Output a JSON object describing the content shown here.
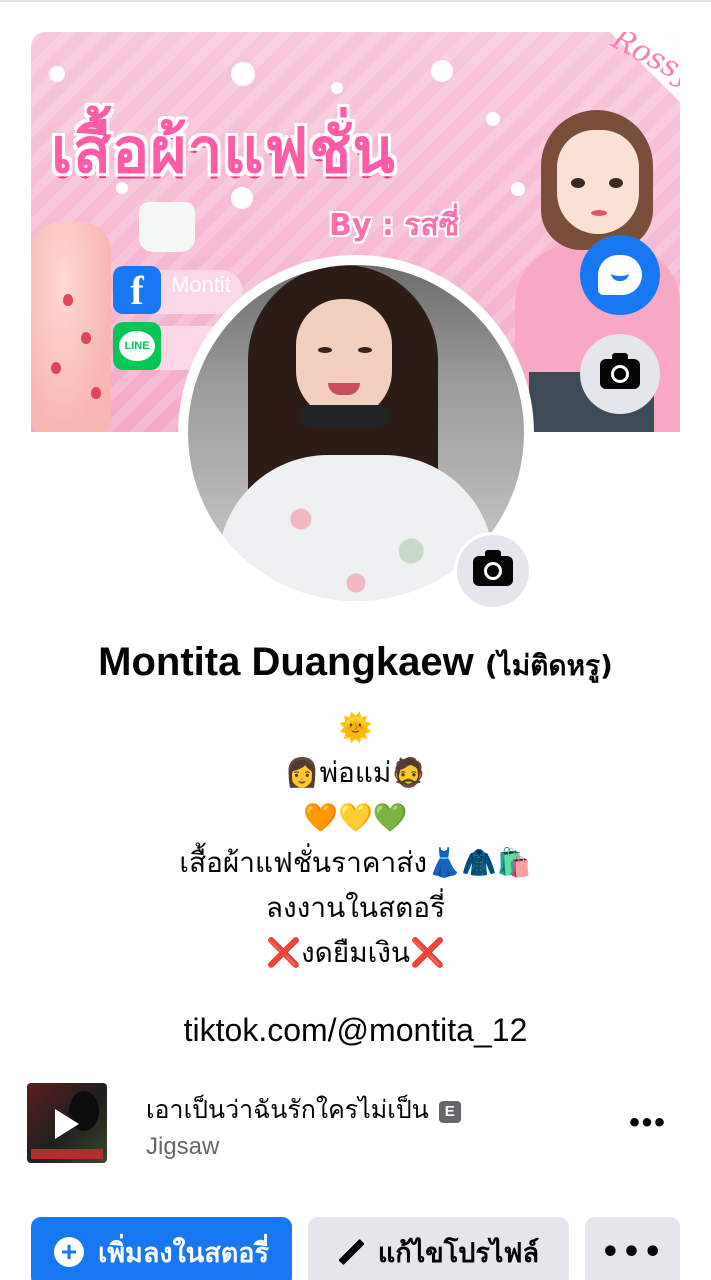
{
  "cover": {
    "title": "เสื้อผ้าแฟชั่น",
    "byline": "By : รสซี่",
    "signature": "Rossy",
    "facebook_text": "Montit"
  },
  "profile": {
    "name": "Montita Duangkaew",
    "nickname": "(ไม่ติดหรู)",
    "bio_lines": [
      "🌞",
      "👩พ่อแม่🧔",
      "🧡💛💚",
      "เสื้อผ้าแฟชั่นราคาส่ง👗🧥🛍️",
      "ลงงานในสตอรี่",
      "❌งดยืมเงิน❌"
    ],
    "link": "tiktok.com/@montita_12"
  },
  "music": {
    "song_title": "เอาเป็นว่าฉันรักใครไม่เป็น",
    "explicit": "E",
    "artist": "Jigsaw"
  },
  "actions": {
    "add_story": "เพิ่มลงในสตอรี่",
    "edit_profile": "แก้ไขโปรไฟล์",
    "more": "•••"
  },
  "more_menu": "•••",
  "colors": {
    "brand_blue": "#1877f2",
    "button_gray": "#e4e6eb",
    "secondary_text": "#65676b"
  },
  "icons": {
    "messenger": "messenger-icon",
    "camera": "camera-icon",
    "play": "play-icon",
    "plus": "plus-circle-icon",
    "pencil": "pencil-icon",
    "more": "more-horizontal-icon"
  }
}
